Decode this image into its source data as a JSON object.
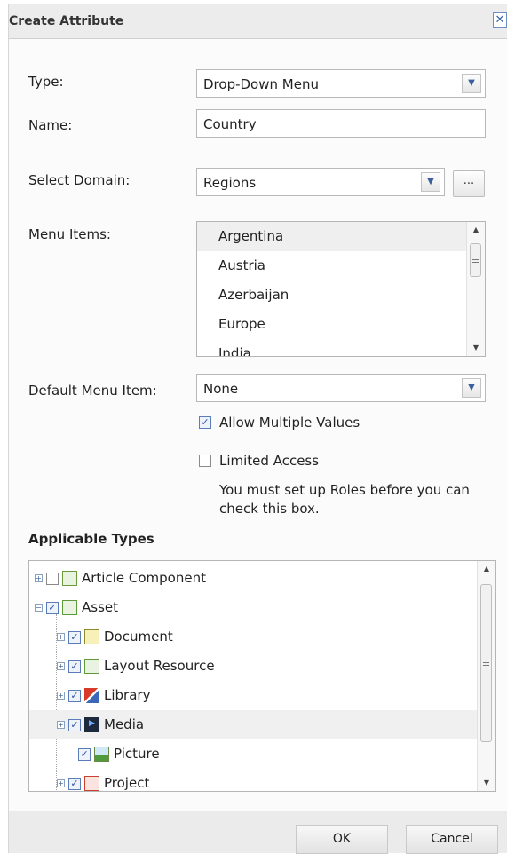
{
  "dialog": {
    "title": "Create Attribute",
    "close_glyph": "✕"
  },
  "form": {
    "type_label": "Type:",
    "type_value": "Drop-Down Menu",
    "name_label": "Name:",
    "name_value": "Country",
    "domain_label": "Select Domain:",
    "domain_value": "Regions",
    "domain_browse_label": "...",
    "menu_items_label": "Menu Items:",
    "menu_items": [
      "Argentina",
      "Austria",
      "Azerbaijan",
      "Europe",
      "India"
    ],
    "default_label": "Default Menu Item:",
    "default_value": "None",
    "allow_multiple_label": "Allow Multiple Values",
    "allow_multiple_checked": true,
    "limited_access_label": "Limited Access",
    "limited_access_checked": false,
    "limited_access_note": "You must set up Roles before you can check this box."
  },
  "applicable_types": {
    "heading": "Applicable Types",
    "items": [
      {
        "label": "Article Component",
        "checked": false,
        "icon": "article-component-icon"
      },
      {
        "label": "Asset",
        "checked": true,
        "icon": "asset-icon"
      },
      {
        "label": "Document",
        "checked": true,
        "icon": "document-icon"
      },
      {
        "label": "Layout Resource",
        "checked": true,
        "icon": "layout-resource-icon"
      },
      {
        "label": "Library",
        "checked": true,
        "icon": "library-icon"
      },
      {
        "label": "Media",
        "checked": true,
        "icon": "media-icon"
      },
      {
        "label": "Picture",
        "checked": true,
        "icon": "picture-icon"
      },
      {
        "label": "Project",
        "checked": true,
        "icon": "project-icon"
      }
    ]
  },
  "footer": {
    "ok_label": "OK",
    "cancel_label": "Cancel"
  },
  "colors": {
    "accent": "#3a64a8",
    "title_bar": "#ececec"
  }
}
